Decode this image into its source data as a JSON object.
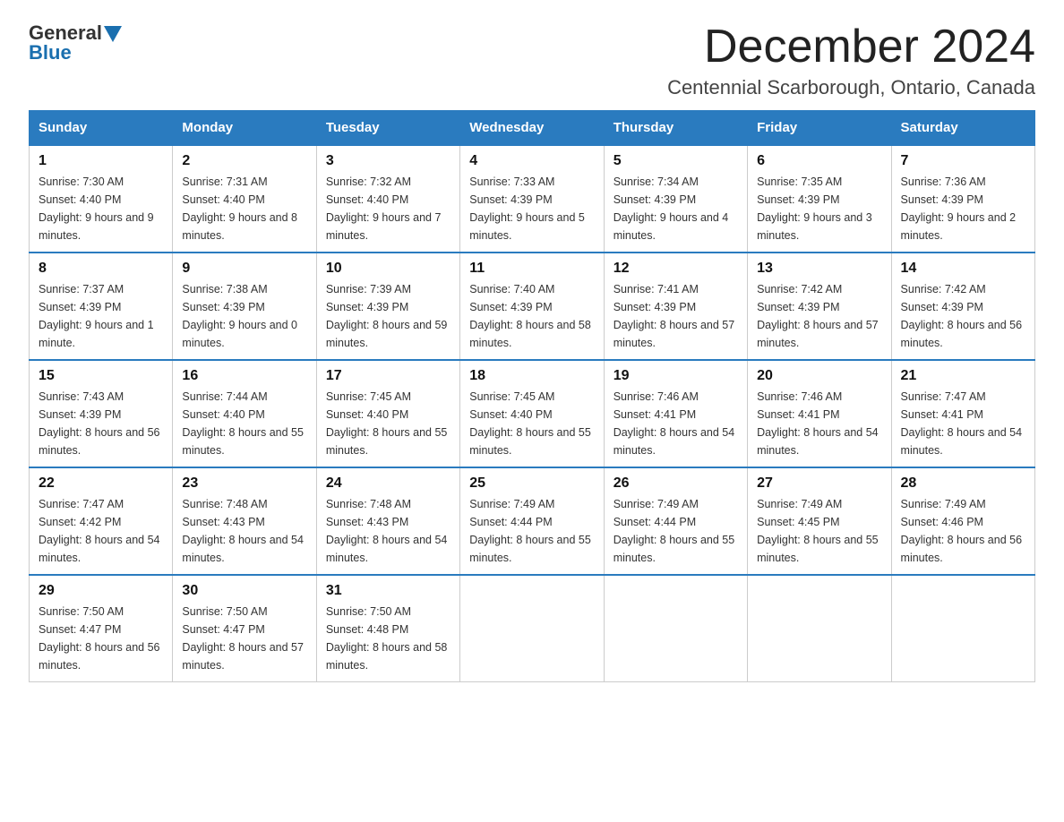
{
  "logo": {
    "text_general": "General",
    "text_blue": "Blue"
  },
  "title": "December 2024",
  "subtitle": "Centennial Scarborough, Ontario, Canada",
  "days_of_week": [
    "Sunday",
    "Monday",
    "Tuesday",
    "Wednesday",
    "Thursday",
    "Friday",
    "Saturday"
  ],
  "weeks": [
    [
      {
        "day": "1",
        "sunrise": "7:30 AM",
        "sunset": "4:40 PM",
        "daylight": "9 hours and 9 minutes."
      },
      {
        "day": "2",
        "sunrise": "7:31 AM",
        "sunset": "4:40 PM",
        "daylight": "9 hours and 8 minutes."
      },
      {
        "day": "3",
        "sunrise": "7:32 AM",
        "sunset": "4:40 PM",
        "daylight": "9 hours and 7 minutes."
      },
      {
        "day": "4",
        "sunrise": "7:33 AM",
        "sunset": "4:39 PM",
        "daylight": "9 hours and 5 minutes."
      },
      {
        "day": "5",
        "sunrise": "7:34 AM",
        "sunset": "4:39 PM",
        "daylight": "9 hours and 4 minutes."
      },
      {
        "day": "6",
        "sunrise": "7:35 AM",
        "sunset": "4:39 PM",
        "daylight": "9 hours and 3 minutes."
      },
      {
        "day": "7",
        "sunrise": "7:36 AM",
        "sunset": "4:39 PM",
        "daylight": "9 hours and 2 minutes."
      }
    ],
    [
      {
        "day": "8",
        "sunrise": "7:37 AM",
        "sunset": "4:39 PM",
        "daylight": "9 hours and 1 minute."
      },
      {
        "day": "9",
        "sunrise": "7:38 AM",
        "sunset": "4:39 PM",
        "daylight": "9 hours and 0 minutes."
      },
      {
        "day": "10",
        "sunrise": "7:39 AM",
        "sunset": "4:39 PM",
        "daylight": "8 hours and 59 minutes."
      },
      {
        "day": "11",
        "sunrise": "7:40 AM",
        "sunset": "4:39 PM",
        "daylight": "8 hours and 58 minutes."
      },
      {
        "day": "12",
        "sunrise": "7:41 AM",
        "sunset": "4:39 PM",
        "daylight": "8 hours and 57 minutes."
      },
      {
        "day": "13",
        "sunrise": "7:42 AM",
        "sunset": "4:39 PM",
        "daylight": "8 hours and 57 minutes."
      },
      {
        "day": "14",
        "sunrise": "7:42 AM",
        "sunset": "4:39 PM",
        "daylight": "8 hours and 56 minutes."
      }
    ],
    [
      {
        "day": "15",
        "sunrise": "7:43 AM",
        "sunset": "4:39 PM",
        "daylight": "8 hours and 56 minutes."
      },
      {
        "day": "16",
        "sunrise": "7:44 AM",
        "sunset": "4:40 PM",
        "daylight": "8 hours and 55 minutes."
      },
      {
        "day": "17",
        "sunrise": "7:45 AM",
        "sunset": "4:40 PM",
        "daylight": "8 hours and 55 minutes."
      },
      {
        "day": "18",
        "sunrise": "7:45 AM",
        "sunset": "4:40 PM",
        "daylight": "8 hours and 55 minutes."
      },
      {
        "day": "19",
        "sunrise": "7:46 AM",
        "sunset": "4:41 PM",
        "daylight": "8 hours and 54 minutes."
      },
      {
        "day": "20",
        "sunrise": "7:46 AM",
        "sunset": "4:41 PM",
        "daylight": "8 hours and 54 minutes."
      },
      {
        "day": "21",
        "sunrise": "7:47 AM",
        "sunset": "4:41 PM",
        "daylight": "8 hours and 54 minutes."
      }
    ],
    [
      {
        "day": "22",
        "sunrise": "7:47 AM",
        "sunset": "4:42 PM",
        "daylight": "8 hours and 54 minutes."
      },
      {
        "day": "23",
        "sunrise": "7:48 AM",
        "sunset": "4:43 PM",
        "daylight": "8 hours and 54 minutes."
      },
      {
        "day": "24",
        "sunrise": "7:48 AM",
        "sunset": "4:43 PM",
        "daylight": "8 hours and 54 minutes."
      },
      {
        "day": "25",
        "sunrise": "7:49 AM",
        "sunset": "4:44 PM",
        "daylight": "8 hours and 55 minutes."
      },
      {
        "day": "26",
        "sunrise": "7:49 AM",
        "sunset": "4:44 PM",
        "daylight": "8 hours and 55 minutes."
      },
      {
        "day": "27",
        "sunrise": "7:49 AM",
        "sunset": "4:45 PM",
        "daylight": "8 hours and 55 minutes."
      },
      {
        "day": "28",
        "sunrise": "7:49 AM",
        "sunset": "4:46 PM",
        "daylight": "8 hours and 56 minutes."
      }
    ],
    [
      {
        "day": "29",
        "sunrise": "7:50 AM",
        "sunset": "4:47 PM",
        "daylight": "8 hours and 56 minutes."
      },
      {
        "day": "30",
        "sunrise": "7:50 AM",
        "sunset": "4:47 PM",
        "daylight": "8 hours and 57 minutes."
      },
      {
        "day": "31",
        "sunrise": "7:50 AM",
        "sunset": "4:48 PM",
        "daylight": "8 hours and 58 minutes."
      },
      null,
      null,
      null,
      null
    ]
  ],
  "labels": {
    "sunrise": "Sunrise:",
    "sunset": "Sunset:",
    "daylight": "Daylight:"
  }
}
